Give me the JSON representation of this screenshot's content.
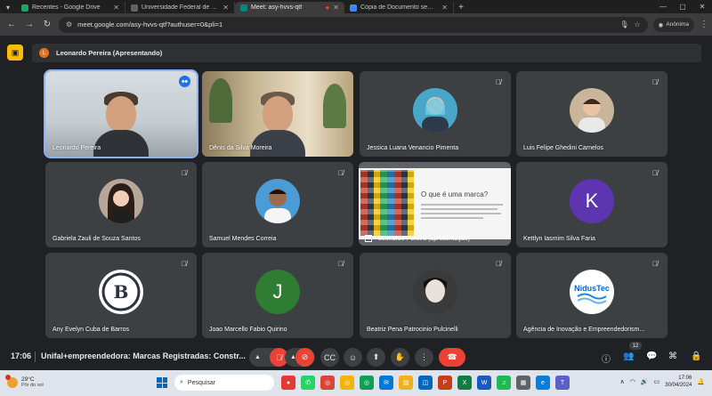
{
  "browser": {
    "tabs": [
      {
        "title": "Recentes - Google Drive",
        "color": "#1fa463"
      },
      {
        "title": "Universidade Federal de Alfenas",
        "color": "#5f6368"
      },
      {
        "title": "Meet: asy-hvvs-qtf",
        "color": "#00897b",
        "active": true
      },
      {
        "title": "Cópia de Documento sem título",
        "color": "#4285f4"
      }
    ],
    "url": "meet.google.com/asy-hvvs-qtf?authuser=0&pli=1",
    "profile_label": "Anônima"
  },
  "meet": {
    "presenter_initial": "L",
    "presenter_banner": "Leonardo Pereira (Apresentando)",
    "participants": [
      {
        "name": "Leonardo Pereira",
        "kind": "camera"
      },
      {
        "name": "Dênis da Silva Moreira",
        "kind": "camera"
      },
      {
        "name": "Jessica Luana Venancio Pimenta",
        "kind": "photo",
        "color": "#4aa6c9"
      },
      {
        "name": "Luis Felipe Ghedini Carnelos",
        "kind": "photo",
        "color": "#c9b59a"
      },
      {
        "name": "Gabriela Zauli de Souza Santos",
        "kind": "photo",
        "color": "#b9a69a"
      },
      {
        "name": "Samuel Mendes Correia",
        "kind": "photo",
        "color": "#4a9bd6"
      },
      {
        "name": "Kettlyn Iasmim Silva Faria",
        "kind": "letter",
        "letter": "K",
        "color": "#5e35b1"
      },
      {
        "name": "Any Evelyn Cuba de Barros",
        "kind": "photo",
        "color": "#ffffff"
      },
      {
        "name": "Joao Marcello Fabio Quirino",
        "kind": "letter",
        "letter": "J",
        "color": "#2e7d32"
      },
      {
        "name": "Beatriz Pena Patrocinio Pulcinelli",
        "kind": "photo",
        "color": "#3a3a3a"
      },
      {
        "name": "Agência de Inovação e Empreendedorism...",
        "kind": "photo",
        "color": "#ffffff"
      }
    ],
    "slide": {
      "title": "O que é uma marca?",
      "presenter_label": "Leonardo Pereira (apresentação)"
    },
    "clock": "17:06",
    "meeting_title": "Unifal+empreendedora: Marcas Registradas: Constr...",
    "participant_count": "12"
  },
  "taskbar": {
    "temperature": "29°C",
    "weather_sub": "Pôr do sol",
    "search_placeholder": "Pesquisar",
    "time": "17:06",
    "date": "30/04/2024"
  }
}
